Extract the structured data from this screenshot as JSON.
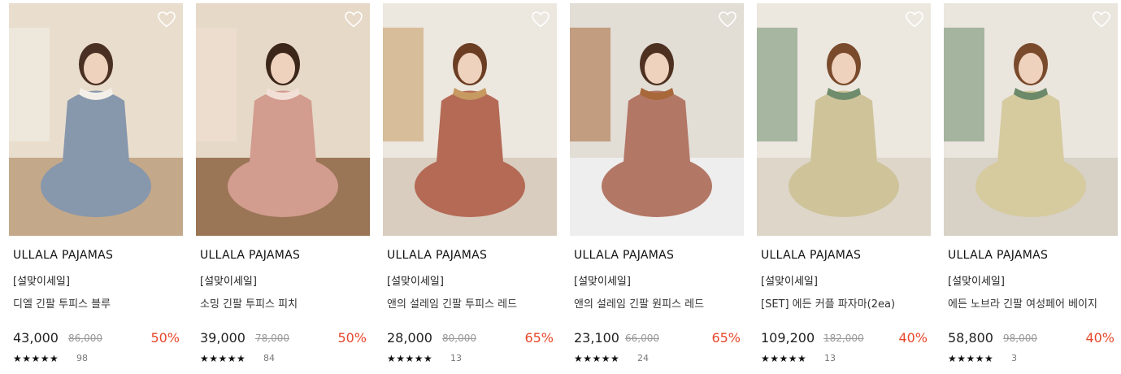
{
  "products": [
    {
      "brand": "ULLALA PAJAMAS",
      "tag": "[설맞이세일]",
      "name": "디엘 긴팔 투피스 블루",
      "price": "43,000",
      "original": "86,000",
      "discount": "50%",
      "rating": "★★★★★",
      "reviews": "98",
      "palette": {
        "bg": "#e9ddcd",
        "floor": "#c4a88a",
        "figure": "#8797ac",
        "accent": "#f3efe8",
        "hair": "#4a3022"
      }
    },
    {
      "brand": "ULLALA PAJAMAS",
      "tag": "[설맞이세일]",
      "name": "소밍 긴팔 투피스 피치",
      "price": "39,000",
      "original": "78,000",
      "discount": "50%",
      "rating": "★★★★★",
      "reviews": "84",
      "palette": {
        "bg": "#e6d9c8",
        "floor": "#9a7556",
        "figure": "#d29c8f",
        "accent": "#f2e0d6",
        "hair": "#3b2619"
      }
    },
    {
      "brand": "ULLALA PAJAMAS",
      "tag": "[설맞이세일]",
      "name": "앤의 설레임 긴팔 투피스 레드",
      "price": "28,000",
      "original": "80,000",
      "discount": "65%",
      "rating": "★★★★★",
      "reviews": "13",
      "palette": {
        "bg": "#ece7df",
        "floor": "#d9cdbf",
        "figure": "#b46a55",
        "accent": "#c69a61",
        "hair": "#6b3d22"
      }
    },
    {
      "brand": "ULLALA PAJAMAS",
      "tag": "[설맞이세일]",
      "name": "앤의 설레임 긴팔 원피스 레드",
      "price": "23,100",
      "original": "66,000",
      "discount": "65%",
      "rating": "★★★★★",
      "reviews": "24",
      "palette": {
        "bg": "#e2ddd5",
        "floor": "#eeeeee",
        "figure": "#b37766",
        "accent": "#a8683a",
        "hair": "#4d3020"
      }
    },
    {
      "brand": "ULLALA PAJAMAS",
      "tag": "[설맞이세일]",
      "name": "[SET] 에든 커플 파자마(2ea)",
      "price": "109,200",
      "original": "182,000",
      "discount": "40%",
      "rating": "★★★★★",
      "reviews": "13",
      "palette": {
        "bg": "#ece8df",
        "floor": "#ddd6c9",
        "figure": "#cfc39a",
        "accent": "#6f8c6d",
        "hair": "#7a4a2c"
      }
    },
    {
      "brand": "ULLALA PAJAMAS",
      "tag": "[설맞이세일]",
      "name": "에든 노브라 긴팔 여성페어 베이지",
      "price": "58,800",
      "original": "98,000",
      "discount": "40%",
      "rating": "★★★★★",
      "reviews": "3",
      "palette": {
        "bg": "#eae6de",
        "floor": "#d7d1c6",
        "figure": "#d6ca9f",
        "accent": "#6c8a6a",
        "hair": "#7a4a2c"
      }
    }
  ]
}
